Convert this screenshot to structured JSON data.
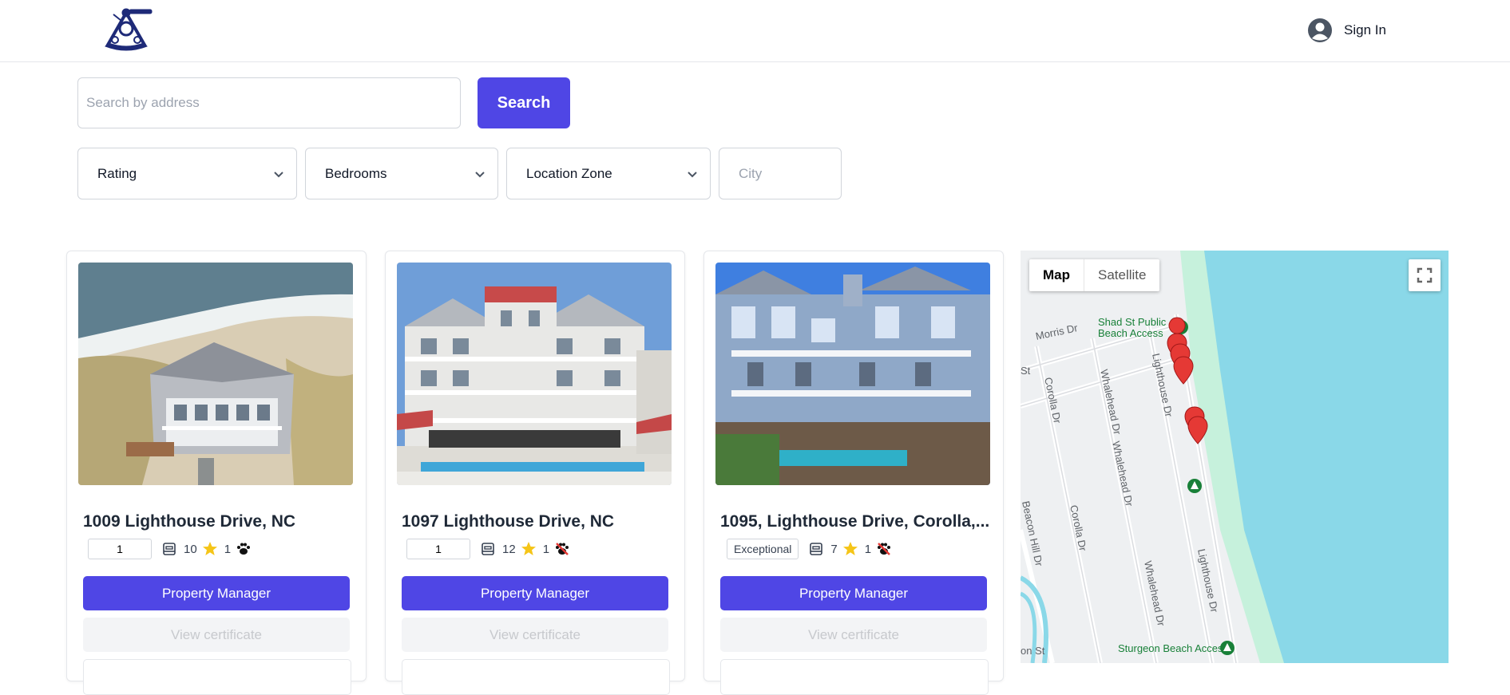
{
  "header": {
    "signin_label": "Sign In"
  },
  "search": {
    "placeholder": "Search by address",
    "button_label": "Search"
  },
  "filters": {
    "rating": "Rating",
    "bedrooms": "Bedrooms",
    "location_zone": "Location Zone",
    "city_placeholder": "City"
  },
  "listings": [
    {
      "title": "1009 Lighthouse Drive, NC",
      "quantity": "1",
      "bedrooms": "10",
      "rating": "1",
      "pets": "allowed",
      "manager_label": "Property Manager",
      "certificate_label": "View certificate"
    },
    {
      "title": "1097 Lighthouse Drive, NC",
      "quantity": "1",
      "bedrooms": "12",
      "rating": "1",
      "pets": "not allowed",
      "manager_label": "Property Manager",
      "certificate_label": "View certificate"
    },
    {
      "title": "1095, Lighthouse Drive, Corolla,...",
      "badge": "Exceptional",
      "bedrooms": "7",
      "rating": "1",
      "pets": "not allowed",
      "manager_label": "Property Manager",
      "certificate_label": "View certificate"
    }
  ],
  "map": {
    "tab_map": "Map",
    "tab_satellite": "Satellite",
    "labels": {
      "shad_st": "Shad St Public",
      "beach_access": "Beach Access",
      "morris_dr": "Morris Dr",
      "st": "St",
      "corolla_dr_1": "Corolla Dr",
      "corolla_dr_2": "Corolla Dr",
      "whalehead_dr_1": "Whalehead Dr",
      "whalehead_dr_2": "Whalehead Dr",
      "whalehead_dr_3": "Whalehead Dr",
      "lighthouse_dr_1": "Lighthouse Dr",
      "lighthouse_dr_2": "Lighthouse Dr",
      "beacon_hill_dr": "Beacon Hill Dr",
      "sturgeon": "Sturgeon Beach Access",
      "st_bottom": "on St"
    }
  },
  "colors": {
    "accent": "#4f46e5",
    "star": "#f5c518",
    "ocean": "#8ad8e8",
    "beach": "#c6f1dc",
    "pin": "#e53935"
  }
}
